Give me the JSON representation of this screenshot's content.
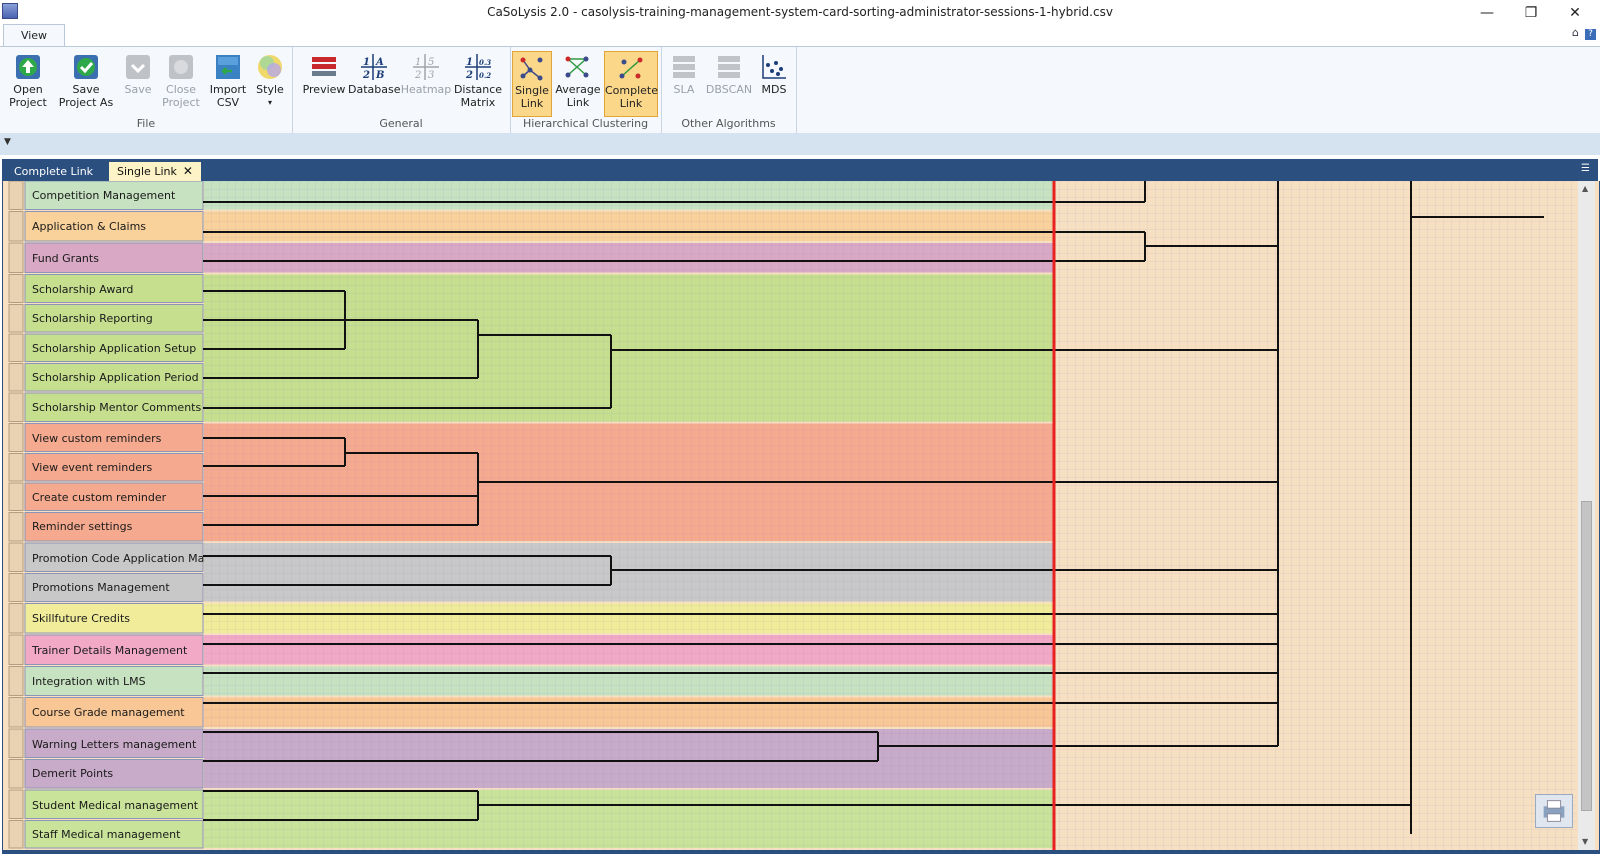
{
  "window": {
    "title": "CaSoLysis 2.0 - casolysis-training-management-system-card-sorting-administrator-sessions-1-hybrid.csv",
    "minimize_glyph": "—",
    "restore_glyph": "❐",
    "close_glyph": "✕"
  },
  "ribbon_tabs": {
    "view": "View"
  },
  "help": {
    "home_glyph": "⌂",
    "question": "?"
  },
  "ribbon": {
    "file": {
      "label": "File",
      "open": [
        "Open",
        "Project"
      ],
      "save_as": [
        "Save",
        "Project As"
      ],
      "save": [
        "Save",
        ""
      ],
      "close": [
        "Close",
        "Project"
      ],
      "import": [
        "Import",
        "CSV"
      ],
      "style": [
        "Style",
        "▾"
      ]
    },
    "general": {
      "label": "General",
      "preview": "Preview",
      "database": "Database",
      "heatmap": "Heatmap",
      "distance": [
        "Distance",
        "Matrix"
      ]
    },
    "hierarchical": {
      "label": "Hierarchical Clustering",
      "single": [
        "Single",
        "Link"
      ],
      "average": [
        "Average",
        "Link"
      ],
      "complete": [
        "Complete",
        "Link"
      ]
    },
    "other": {
      "label": "Other Algorithms",
      "sla": "SLA",
      "dbscan": "DBSCAN",
      "mds": "MDS"
    }
  },
  "doc_tabs": {
    "complete": "Complete Link",
    "single": "Single Link",
    "close_glyph": "✕"
  },
  "dendrogram": {
    "rows": [
      {
        "label": "Competition Management",
        "color": "#c6e2c1"
      },
      {
        "label": "Application & Claims",
        "color": "#f8d19b"
      },
      {
        "label": "Fund   Grants",
        "color": "#d8a8c4"
      },
      {
        "label": "Scholarship Award",
        "color": "#c5df8f"
      },
      {
        "label": "Scholarship Reporting",
        "color": "#c5df8f"
      },
      {
        "label": "Scholarship Application Setup",
        "color": "#c5df8f"
      },
      {
        "label": "Scholarship Application Period",
        "color": "#c5df8f"
      },
      {
        "label": "Scholarship Mentor Comments",
        "color": "#c5df8f"
      },
      {
        "label": "View custom reminders",
        "color": "#f5a98f"
      },
      {
        "label": "View event reminders",
        "color": "#f5a98f"
      },
      {
        "label": "Create custom reminder",
        "color": "#f5a98f"
      },
      {
        "label": "Reminder settings",
        "color": "#f5a98f"
      },
      {
        "label": "Promotion Code Application   Ma",
        "color": "#c8c8c8"
      },
      {
        "label": "Promotions Management",
        "color": "#c8c8c8"
      },
      {
        "label": "Skillfuture Credits",
        "color": "#f0ec9a"
      },
      {
        "label": "Trainer Details Management",
        "color": "#f2a9c6"
      },
      {
        "label": "Integration with LMS",
        "color": "#c6e2c1"
      },
      {
        "label": "Course   Grade management",
        "color": "#f8c795"
      },
      {
        "label": "Warning Letters management",
        "color": "#c8abc8"
      },
      {
        "label": "Demerit Points",
        "color": "#c8abc8"
      },
      {
        "label": "Student Medical management",
        "color": "#c9e39a"
      },
      {
        "label": "Staff Medical management",
        "color": "#c9e39a"
      }
    ],
    "cutoff_color": "#e82020",
    "line_color": "#111111"
  }
}
